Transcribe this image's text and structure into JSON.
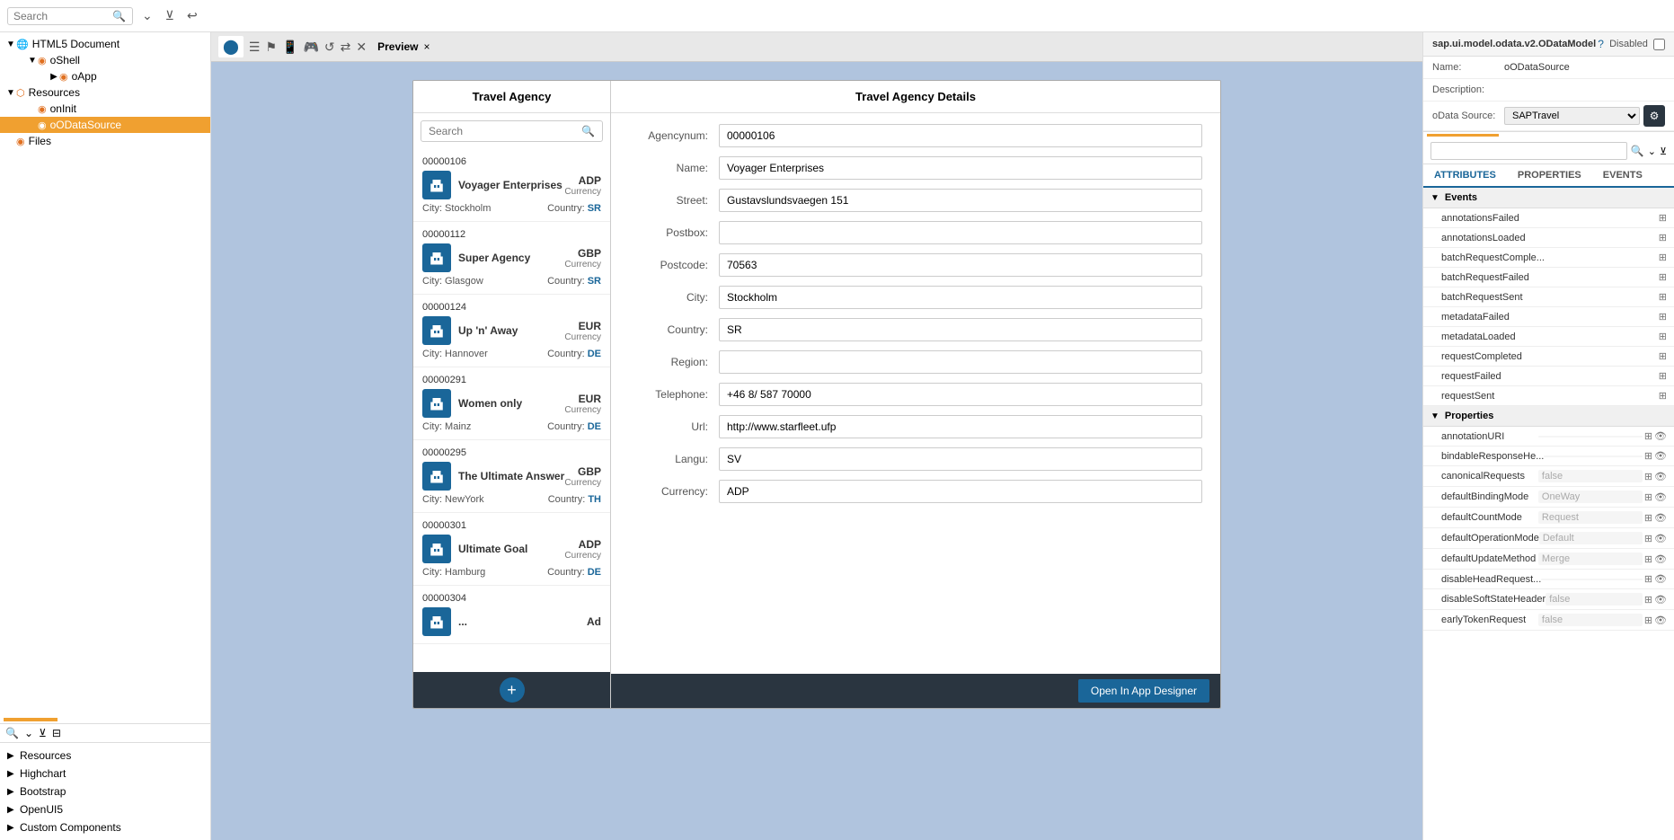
{
  "toolbar": {
    "search_placeholder": "Search"
  },
  "tree": {
    "items": [
      {
        "id": "html5doc",
        "label": "HTML5 Document",
        "level": 0,
        "type": "html",
        "expanded": true
      },
      {
        "id": "oshell",
        "label": "oShell",
        "level": 1,
        "type": "oshell",
        "expanded": true
      },
      {
        "id": "oapp",
        "label": "oApp",
        "level": 2,
        "type": "oapp",
        "expanded": false
      },
      {
        "id": "resources",
        "label": "Resources",
        "level": 0,
        "type": "resources",
        "expanded": true
      },
      {
        "id": "onInit",
        "label": "onInit",
        "level": 1,
        "type": "script"
      },
      {
        "id": "oODataSource",
        "label": "oODataSource",
        "level": 1,
        "type": "datasource",
        "selected": true
      },
      {
        "id": "files",
        "label": "Files",
        "level": 0,
        "type": "folder"
      }
    ]
  },
  "bottom_tree": {
    "items": [
      {
        "id": "resources",
        "label": "Resources",
        "expanded": false
      },
      {
        "id": "highchart",
        "label": "Highchart",
        "expanded": false
      },
      {
        "id": "bootstrap",
        "label": "Bootstrap",
        "expanded": false
      },
      {
        "id": "openuis",
        "label": "OpenUI5",
        "expanded": false
      },
      {
        "id": "custom",
        "label": "Custom Components",
        "expanded": false
      }
    ]
  },
  "preview": {
    "label": "Preview",
    "close": "×"
  },
  "agency_panel": {
    "title": "Travel Agency",
    "search_placeholder": "Search",
    "items": [
      {
        "id": "00000106",
        "name": "Voyager Enterprises",
        "currency": "ADP",
        "currency_label": "Currency",
        "city": "Stockholm",
        "country": "SR"
      },
      {
        "id": "00000112",
        "name": "Super Agency",
        "currency": "GBP",
        "currency_label": "Currency",
        "city": "Glasgow",
        "country": "SR"
      },
      {
        "id": "00000124",
        "name": "Up 'n' Away",
        "currency": "EUR",
        "currency_label": "Currency",
        "city": "Hannover",
        "country": "DE"
      },
      {
        "id": "00000291",
        "name": "Women only",
        "currency": "EUR",
        "currency_label": "Currency",
        "city": "Mainz",
        "country": "DE"
      },
      {
        "id": "00000295",
        "name": "The Ultimate Answer",
        "currency": "GBP",
        "currency_label": "Currency",
        "city": "NewYork",
        "country": "TH"
      },
      {
        "id": "00000301",
        "name": "Ultimate Goal",
        "currency": "ADP",
        "currency_label": "Currency",
        "city": "Hamburg",
        "country": "DE"
      },
      {
        "id": "00000304",
        "name": "...",
        "currency": "Ad",
        "currency_label": "",
        "city": "",
        "country": ""
      }
    ],
    "add_button": "+"
  },
  "details_panel": {
    "title": "Travel Agency Details",
    "fields": [
      {
        "label": "Agencynum:",
        "value": "00000106"
      },
      {
        "label": "Name:",
        "value": "Voyager Enterprises"
      },
      {
        "label": "Street:",
        "value": "Gustavslundsvaegen 151"
      },
      {
        "label": "Postbox:",
        "value": ""
      },
      {
        "label": "Postcode:",
        "value": "70563"
      },
      {
        "label": "City:",
        "value": "Stockholm"
      },
      {
        "label": "Country:",
        "value": "SR"
      },
      {
        "label": "Region:",
        "value": ""
      },
      {
        "label": "Telephone:",
        "value": "+46 8/ 587 70000"
      },
      {
        "label": "Url:",
        "value": "http://www.starfleet.ufp"
      },
      {
        "label": "Langu:",
        "value": "SV"
      },
      {
        "label": "Currency:",
        "value": "ADP"
      }
    ],
    "open_designer": "Open In App Designer"
  },
  "right_panel": {
    "model_label": "sap.ui.model.odata.v2.ODataModel",
    "status": "Disabled",
    "name_label": "Name:",
    "name_value": "oODataSource",
    "desc_label": "Description:",
    "desc_value": "",
    "odata_source_label": "oData Source:",
    "odata_source_value": "SAPTravel",
    "tabs": [
      {
        "id": "attributes",
        "label": "ATTRIBUTES"
      },
      {
        "id": "properties",
        "label": "PROPERTIES"
      },
      {
        "id": "events",
        "label": "EVENTS"
      }
    ],
    "active_tab": "attributes",
    "events_section_label": "Events",
    "events": [
      {
        "name": "annotationsFailed",
        "value": ""
      },
      {
        "name": "annotationsLoaded",
        "value": ""
      },
      {
        "name": "batchRequestComple...",
        "value": ""
      },
      {
        "name": "batchRequestFailed",
        "value": ""
      },
      {
        "name": "batchRequestSent",
        "value": ""
      },
      {
        "name": "metadataFailed",
        "value": ""
      },
      {
        "name": "metadataLoaded",
        "value": ""
      },
      {
        "name": "requestCompleted",
        "value": ""
      },
      {
        "name": "requestFailed",
        "value": ""
      },
      {
        "name": "requestSent",
        "value": ""
      }
    ],
    "properties_section_label": "Properties",
    "properties": [
      {
        "name": "annotationURI",
        "value": ""
      },
      {
        "name": "bindableResponseHe...",
        "value": ""
      },
      {
        "name": "canonicalRequests",
        "value": "false"
      },
      {
        "name": "defaultBindingMode",
        "value": "OneWay"
      },
      {
        "name": "defaultCountMode",
        "value": "Request"
      },
      {
        "name": "defaultOperationMode",
        "value": "Default"
      },
      {
        "name": "defaultUpdateMethod",
        "value": "Merge"
      },
      {
        "name": "disableHeadRequest...",
        "value": ""
      },
      {
        "name": "disableSoftStateHeader",
        "value": "false"
      },
      {
        "name": "earlyTokenRequest",
        "value": "false"
      }
    ]
  }
}
